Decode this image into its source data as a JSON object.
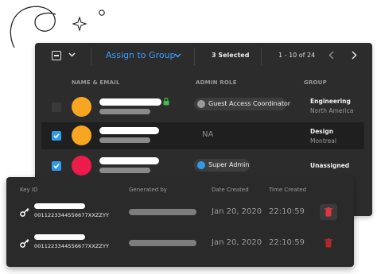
{
  "toolbar": {
    "assign_label": "Assign to Group",
    "selected_label": "3 Selected",
    "pager_label": "1 - 10 of 24"
  },
  "table": {
    "headers": {
      "name": "NAME & EMAIL",
      "role": "ADMIN ROLE",
      "group": "GROUP"
    },
    "rows": [
      {
        "checked": false,
        "avatar_color": "#f8a622",
        "role": "Guest Access Coordinator",
        "role_dot": "#9a9a9a",
        "group": "Engineering",
        "group_sub": "North America",
        "lock_color": "#3fbf4a"
      },
      {
        "checked": true,
        "avatar_color": "#f8a622",
        "role": "NA",
        "group": "Design",
        "group_sub": "Montreal"
      },
      {
        "checked": true,
        "avatar_color": "#ee1c4a",
        "role": "Super Admin",
        "role_dot": "#2e9bf0",
        "group": "Unassigned"
      }
    ]
  },
  "keys": {
    "headers": {
      "key_id": "Key ID",
      "generated_by": "Generated by",
      "date_created": "Date Created",
      "time_created": "Time Created"
    },
    "rows": [
      {
        "key_id": "0011223344556677XXZZYY",
        "date": "Jan 20, 2020",
        "time": "22:10:59"
      },
      {
        "key_id": "0011223344556677XXZZYY",
        "date": "Jan 20, 2020",
        "time": "22:10:59"
      }
    ]
  },
  "colors": {
    "accent": "#3aa0ff",
    "delete": "#e0383e",
    "panel": "#2c2c2c"
  }
}
